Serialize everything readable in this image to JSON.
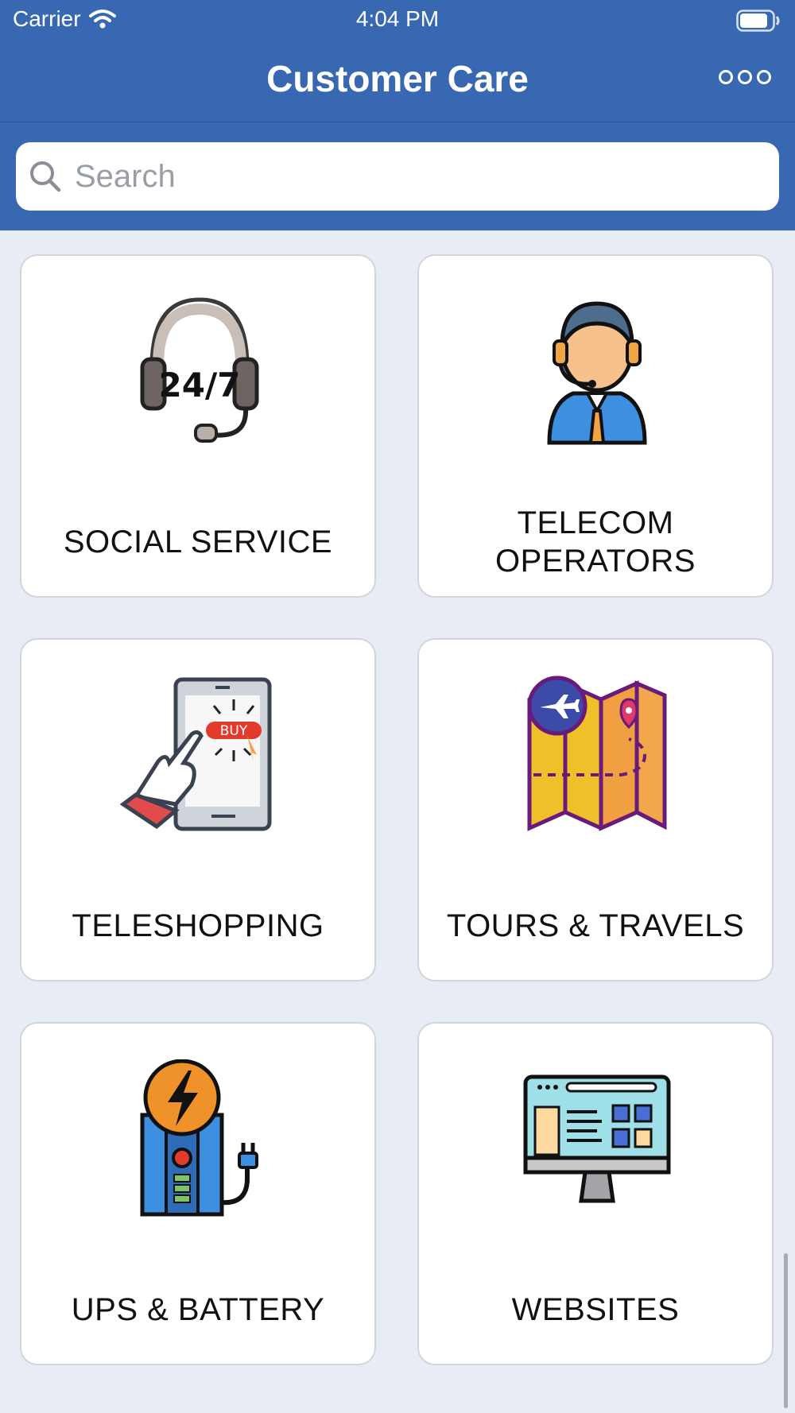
{
  "status_bar": {
    "carrier": "Carrier",
    "time": "4:04 PM"
  },
  "nav": {
    "title": "Customer Care",
    "more_icon": "more-icon"
  },
  "search": {
    "placeholder": "Search",
    "value": ""
  },
  "categories": [
    {
      "label": "SOCIAL SERVICE",
      "icon": "headset-24-7-icon"
    },
    {
      "label": "TELECOM OPERATORS",
      "icon": "support-agent-icon"
    },
    {
      "label": "TELESHOPPING",
      "icon": "tablet-buy-icon"
    },
    {
      "label": "TOURS & TRAVELS",
      "icon": "travel-map-icon"
    },
    {
      "label": "UPS & BATTERY",
      "icon": "ups-battery-icon"
    },
    {
      "label": "WEBSITES",
      "icon": "website-monitor-icon"
    }
  ],
  "colors": {
    "primary": "#3768b1",
    "background": "#e8ecf5",
    "card": "#ffffff"
  }
}
